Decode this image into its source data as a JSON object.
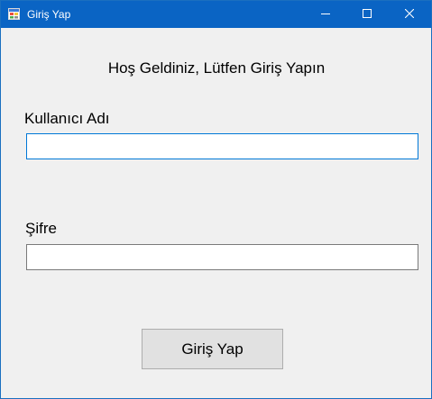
{
  "window": {
    "title": "Giriş Yap",
    "accent_color": "#0a64c4",
    "controls": [
      "minimize-icon",
      "maximize-icon",
      "close-icon"
    ]
  },
  "form": {
    "welcome_text": "Hoş Geldiniz, Lütfen Giriş Yapın",
    "username_label": "Kullanıcı Adı",
    "username_value": "",
    "password_label": "Şifre",
    "password_value": "",
    "login_button_label": "Giriş Yap"
  }
}
